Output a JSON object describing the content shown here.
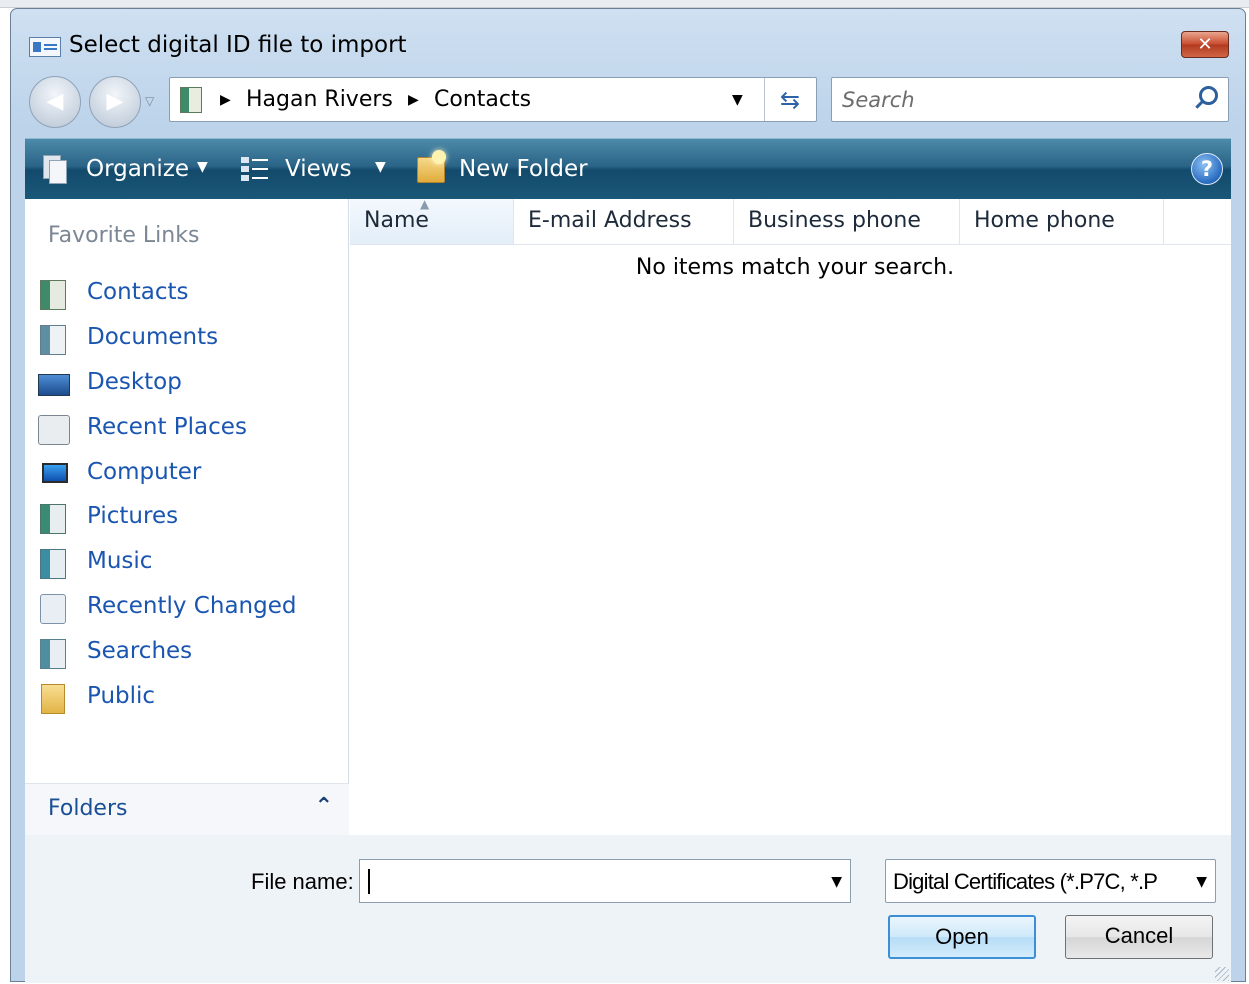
{
  "window": {
    "title": "Select digital ID file to import",
    "close_glyph": "✕"
  },
  "nav": {
    "breadcrumbs": [
      "Hagan Rivers",
      "Contacts"
    ],
    "search_placeholder": "Search"
  },
  "toolbar": {
    "organize_label": "Organize",
    "views_label": "Views",
    "new_folder_label": "New Folder",
    "help_glyph": "?"
  },
  "sidebar": {
    "heading": "Favorite Links",
    "items": [
      {
        "label": "Contacts",
        "icon": "contacts-icon"
      },
      {
        "label": "Documents",
        "icon": "documents-icon"
      },
      {
        "label": "Desktop",
        "icon": "desktop-icon"
      },
      {
        "label": "Recent Places",
        "icon": "recent-places-icon"
      },
      {
        "label": "Computer",
        "icon": "computer-icon"
      },
      {
        "label": "Pictures",
        "icon": "pictures-icon"
      },
      {
        "label": "Music",
        "icon": "music-icon"
      },
      {
        "label": "Recently Changed",
        "icon": "recently-changed-icon"
      },
      {
        "label": "Searches",
        "icon": "searches-icon"
      },
      {
        "label": "Public",
        "icon": "public-icon"
      }
    ],
    "folders_label": "Folders"
  },
  "file_list": {
    "columns": [
      "Name",
      "E-mail Address",
      "Business phone",
      "Home phone"
    ],
    "sorted_column": "Name",
    "empty_message": "No items match your search."
  },
  "footer": {
    "file_name_label": "File name:",
    "file_name_value": "",
    "file_type_value": "Digital Certificates (*.P7C, *.P",
    "open_label": "Open",
    "cancel_label": "Cancel"
  },
  "colors": {
    "link_blue": "#1a55b0",
    "toolbar_dark": "#134a6c",
    "close_red": "#c74a2d",
    "open_button_border": "#3c8fd6"
  }
}
